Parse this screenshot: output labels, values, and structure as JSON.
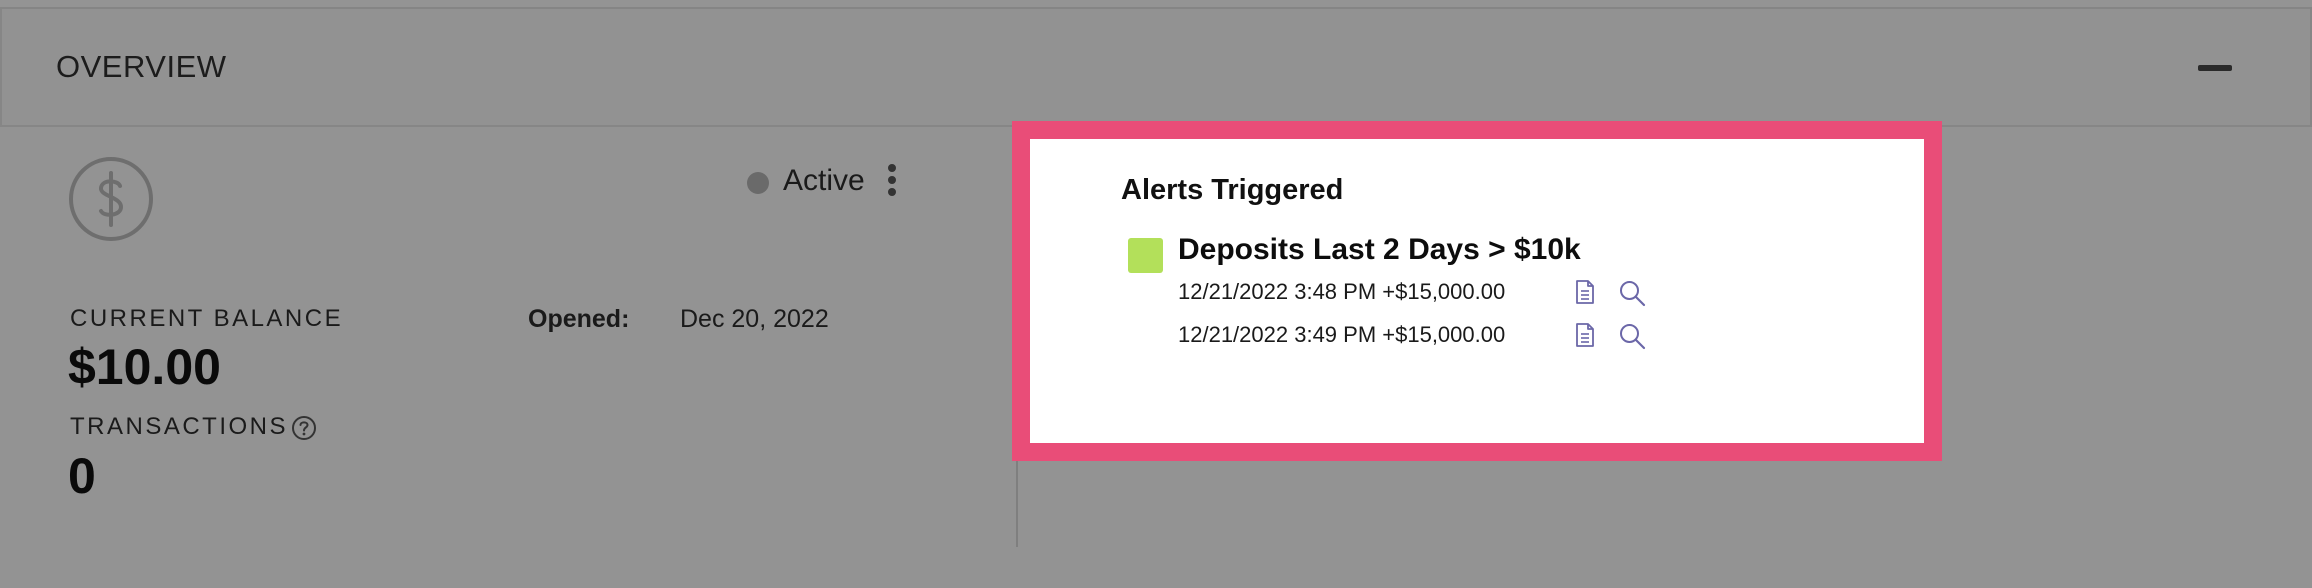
{
  "header": {
    "title": "OVERVIEW"
  },
  "account": {
    "icon": "dollar-circle-icon",
    "status": {
      "label": "Active",
      "dot_color": "#6a6a6a"
    },
    "current_balance": {
      "label": "CURRENT BALANCE",
      "value": "$10.00"
    },
    "opened": {
      "label": "Opened:",
      "value": "Dec 20, 2022"
    },
    "transactions": {
      "label": "TRANSACTIONS",
      "value": "0"
    }
  },
  "alerts": {
    "title": "Alerts Triggered",
    "highlight_color": "#e94d78",
    "items": [
      {
        "name": "Deposits Last 2 Days > $10k",
        "color": "#b3e05a",
        "entries": [
          {
            "text": "12/21/2022 3:48 PM +$15,000.00"
          },
          {
            "text": "12/21/2022 3:49 PM +$15,000.00"
          }
        ]
      }
    ]
  },
  "colors": {
    "background": "#939393",
    "alert_swatch": "#b3e05a",
    "highlight_border": "#e94d78",
    "icon_accent": "#6b67a8"
  }
}
